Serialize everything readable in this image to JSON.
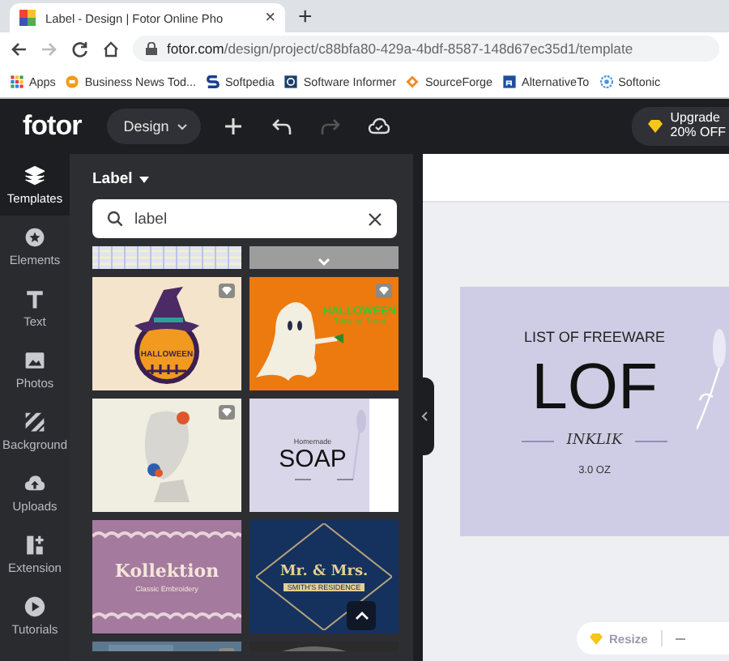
{
  "browser": {
    "tab": {
      "title": "Label - Design | Fotor Online Pho",
      "close": "×"
    },
    "new_tab": "+",
    "address": {
      "domain": "fotor.com",
      "path": "/design/project/c88bfa80-429a-4bdf-8587-148d67ec35d1/template"
    },
    "bookmarks": [
      {
        "label": "Apps",
        "kind": "apps"
      },
      {
        "label": "Business News Tod...",
        "kind": "orange"
      },
      {
        "label": "Softpedia",
        "kind": "s"
      },
      {
        "label": "Software Informer",
        "kind": "box"
      },
      {
        "label": "SourceForge",
        "kind": "diamond"
      },
      {
        "label": "AlternativeTo",
        "kind": "a"
      },
      {
        "label": "Softonic",
        "kind": "ring"
      }
    ]
  },
  "header": {
    "logo": "fotor",
    "design_menu": "Design",
    "upgrade": {
      "line1": "Upgrade",
      "line2": "20% OFF"
    }
  },
  "rail": {
    "items": [
      {
        "label": "Templates",
        "kind": "layers",
        "selected": true
      },
      {
        "label": "Elements",
        "kind": "star",
        "selected": false
      },
      {
        "label": "Text",
        "kind": "text",
        "selected": false
      },
      {
        "label": "Photos",
        "kind": "photo",
        "selected": false
      },
      {
        "label": "Background",
        "kind": "stripes",
        "selected": false
      },
      {
        "label": "Uploads",
        "kind": "upload",
        "selected": false
      },
      {
        "label": "Extension",
        "kind": "ext",
        "selected": false
      },
      {
        "label": "Tutorials",
        "kind": "play",
        "selected": false
      }
    ]
  },
  "panel": {
    "category": "Label",
    "search": {
      "value": "label"
    },
    "templates": [
      {
        "kind": "pattern",
        "premium": false
      },
      {
        "kind": "gray",
        "premium": false
      },
      {
        "kind": "witch",
        "premium": true,
        "title": "HALLOWEEN"
      },
      {
        "kind": "ghost",
        "premium": true,
        "title": "HALLOWEEN",
        "subtitle": "Trick or Treat"
      },
      {
        "kind": "statue",
        "premium": true
      },
      {
        "kind": "soap",
        "premium": false,
        "overline": "Homemade",
        "title": "SOAP"
      },
      {
        "kind": "kollektion",
        "premium": false,
        "title": "Kollektion",
        "subtitle": "Classic Embroidery"
      },
      {
        "kind": "wedding",
        "premium": false,
        "title": "Mr. & Mrs.",
        "subtitle": "SMITH'S RESIDENCE"
      },
      {
        "kind": "slate",
        "premium": true
      },
      {
        "kind": "dark",
        "premium": false
      }
    ]
  },
  "canvas": {
    "design": {
      "heading": "LIST OF FREEWARE",
      "title": "LOF",
      "subtitle": "INKLIK",
      "size": "3.0 OZ"
    },
    "resize": "Resize"
  }
}
